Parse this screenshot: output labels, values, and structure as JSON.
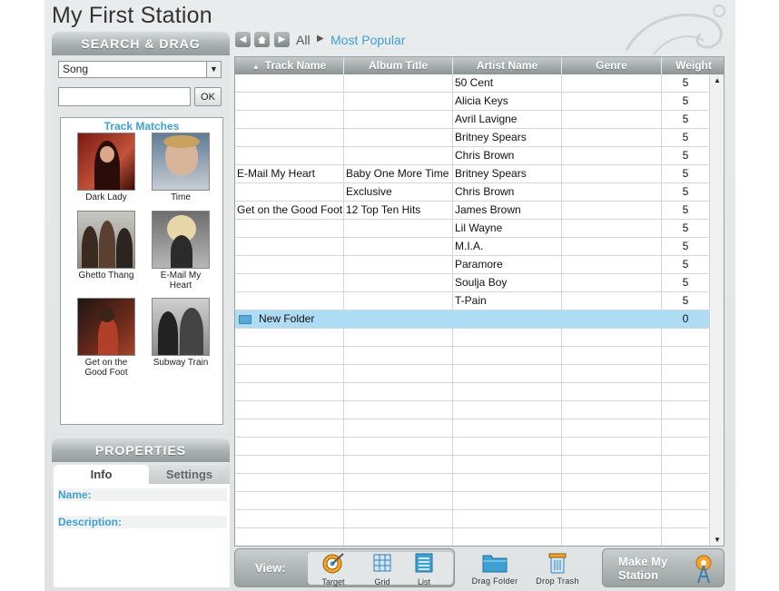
{
  "app": {
    "title": "My First Station"
  },
  "search": {
    "header": "SEARCH & DRAG",
    "type_value": "Song",
    "input_value": "",
    "ok_label": "OK",
    "matches_title": "Track Matches",
    "tracks": [
      {
        "name": "Dark Lady"
      },
      {
        "name": "Time"
      },
      {
        "name": "Ghetto Thang"
      },
      {
        "name": "E-Mail My Heart"
      },
      {
        "name": "Get on the Good Foot"
      },
      {
        "name": "Subway Train"
      }
    ]
  },
  "properties": {
    "header": "PROPERTIES",
    "tabs": {
      "info": "Info",
      "settings": "Settings"
    },
    "fields": {
      "name_label": "Name:",
      "description_label": "Description:"
    }
  },
  "nav": {
    "back_icon": "arrow-left",
    "home_icon": "home",
    "forward_icon": "arrow-right",
    "crumb_all": "All",
    "crumb_current": "Most Popular"
  },
  "grid": {
    "columns": [
      "Track Name",
      "Album Title",
      "Artist Name",
      "Genre",
      "Weight"
    ],
    "sort_indicator": "▲",
    "rows": [
      {
        "track": "",
        "album": "",
        "artist": "50 Cent",
        "genre": "",
        "weight": "5"
      },
      {
        "track": "",
        "album": "",
        "artist": "Alicia Keys",
        "genre": "",
        "weight": "5"
      },
      {
        "track": "",
        "album": "",
        "artist": "Avril Lavigne",
        "genre": "",
        "weight": "5"
      },
      {
        "track": "",
        "album": "",
        "artist": "Britney Spears",
        "genre": "",
        "weight": "5"
      },
      {
        "track": "",
        "album": "",
        "artist": "Chris Brown",
        "genre": "",
        "weight": "5"
      },
      {
        "track": "E-Mail My Heart",
        "album": "Baby One More Time",
        "artist": "Britney Spears",
        "genre": "",
        "weight": "5"
      },
      {
        "track": "",
        "album": "Exclusive",
        "artist": "Chris Brown",
        "genre": "",
        "weight": "5"
      },
      {
        "track": "Get on the Good Foot",
        "album": "12 Top Ten Hits",
        "artist": "James Brown",
        "genre": "",
        "weight": "5"
      },
      {
        "track": "",
        "album": "",
        "artist": "Lil Wayne",
        "genre": "",
        "weight": "5"
      },
      {
        "track": "",
        "album": "",
        "artist": "M.I.A.",
        "genre": "",
        "weight": "5"
      },
      {
        "track": "",
        "album": "",
        "artist": "Paramore",
        "genre": "",
        "weight": "5"
      },
      {
        "track": "",
        "album": "",
        "artist": "Soulja Boy",
        "genre": "",
        "weight": "5"
      },
      {
        "track": "",
        "album": "",
        "artist": "T-Pain",
        "genre": "",
        "weight": "5"
      }
    ],
    "folder": {
      "name": "New Folder",
      "weight": "0"
    }
  },
  "toolbar": {
    "view_label": "View:",
    "views": {
      "target": "Target",
      "grid": "Grid",
      "list": "List"
    },
    "drag_folder": "Drag Folder",
    "drop_trash": "Drop Trash",
    "make_station": "Make My Station"
  },
  "colors": {
    "accent": "#3fa0d2",
    "selected_row": "#aedcf5",
    "panel_header": "#9aa1a1"
  }
}
